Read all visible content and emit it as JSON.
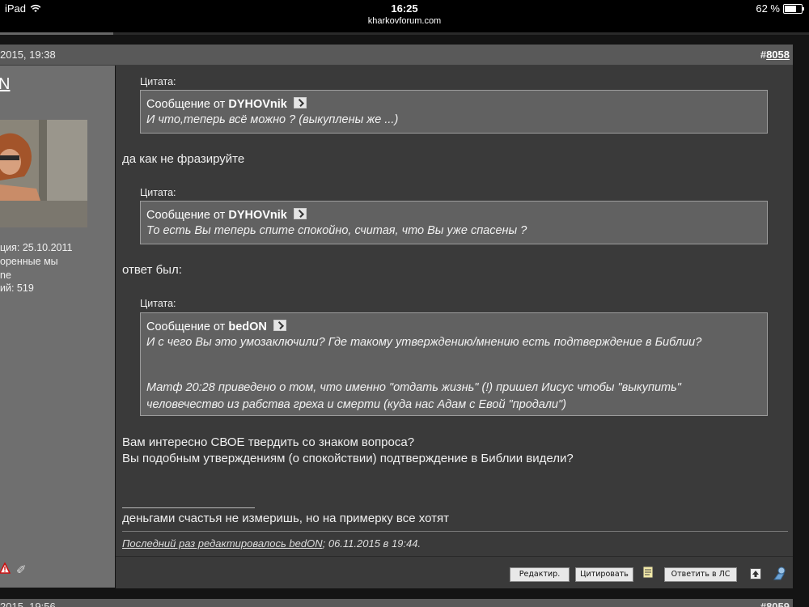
{
  "statusbar": {
    "device": "iPad",
    "time": "16:25",
    "url": "kharkovforum.com",
    "battery": "62 %",
    "page_load_progress": 0.14
  },
  "post": {
    "date": "2015, 19:38",
    "number_prefix": "#",
    "number": "8058",
    "user": {
      "name": "N",
      "registered": "ция: 25.10.2011",
      "line2": "оренные мы",
      "line3": "ne",
      "posts": "ий: 519"
    },
    "quotes": [
      {
        "label": "Цитата:",
        "from_prefix": "Сообщение от",
        "author": "DYHOVnik",
        "text": "И что,теперь всё можно ? (выкуплены же ...)"
      },
      {
        "label": "Цитата:",
        "from_prefix": "Сообщение от",
        "author": "DYHOVnik",
        "text": "То есть Вы теперь спите спокойно, считая, что Вы уже спасены ?"
      },
      {
        "label": "Цитата:",
        "from_prefix": "Сообщение от",
        "author": "bedON",
        "text": "И с чего Вы это умозаключили? Где такому утверждению/мнению есть подтверждение в Библии?",
        "text2_line1": "Матф 20:28 приведено о том, что именно \"отдать жизнь\" (!) пришел Иисус чтобы \"выкупить\"",
        "text2_line2": "человечество из рабства греха и смерти (куда нас Адам с Евой \"продали\")"
      }
    ],
    "reply1": "да как не фразируйте",
    "reply2": "ответ был:",
    "reply3_line1": "Вам интересно СВОЕ твердить со знаком вопроса?",
    "reply3_line2": "Вы подобным утверждениям (о спокойствии) подтверждение в Библии видели?",
    "signature": "деньгами счастья не измеришь, но на примерку все хотят",
    "edited_prefix": "Последний раз редактировалось bedON",
    "edited_suffix": "; 06.11.2015 в 19:44.",
    "buttons": {
      "edit": "Редактир.",
      "quote": "Цитировать",
      "reply_pm": "Ответить в ЛС"
    }
  },
  "next_post": {
    "date": "2015, 19:56",
    "number": "#8059"
  }
}
